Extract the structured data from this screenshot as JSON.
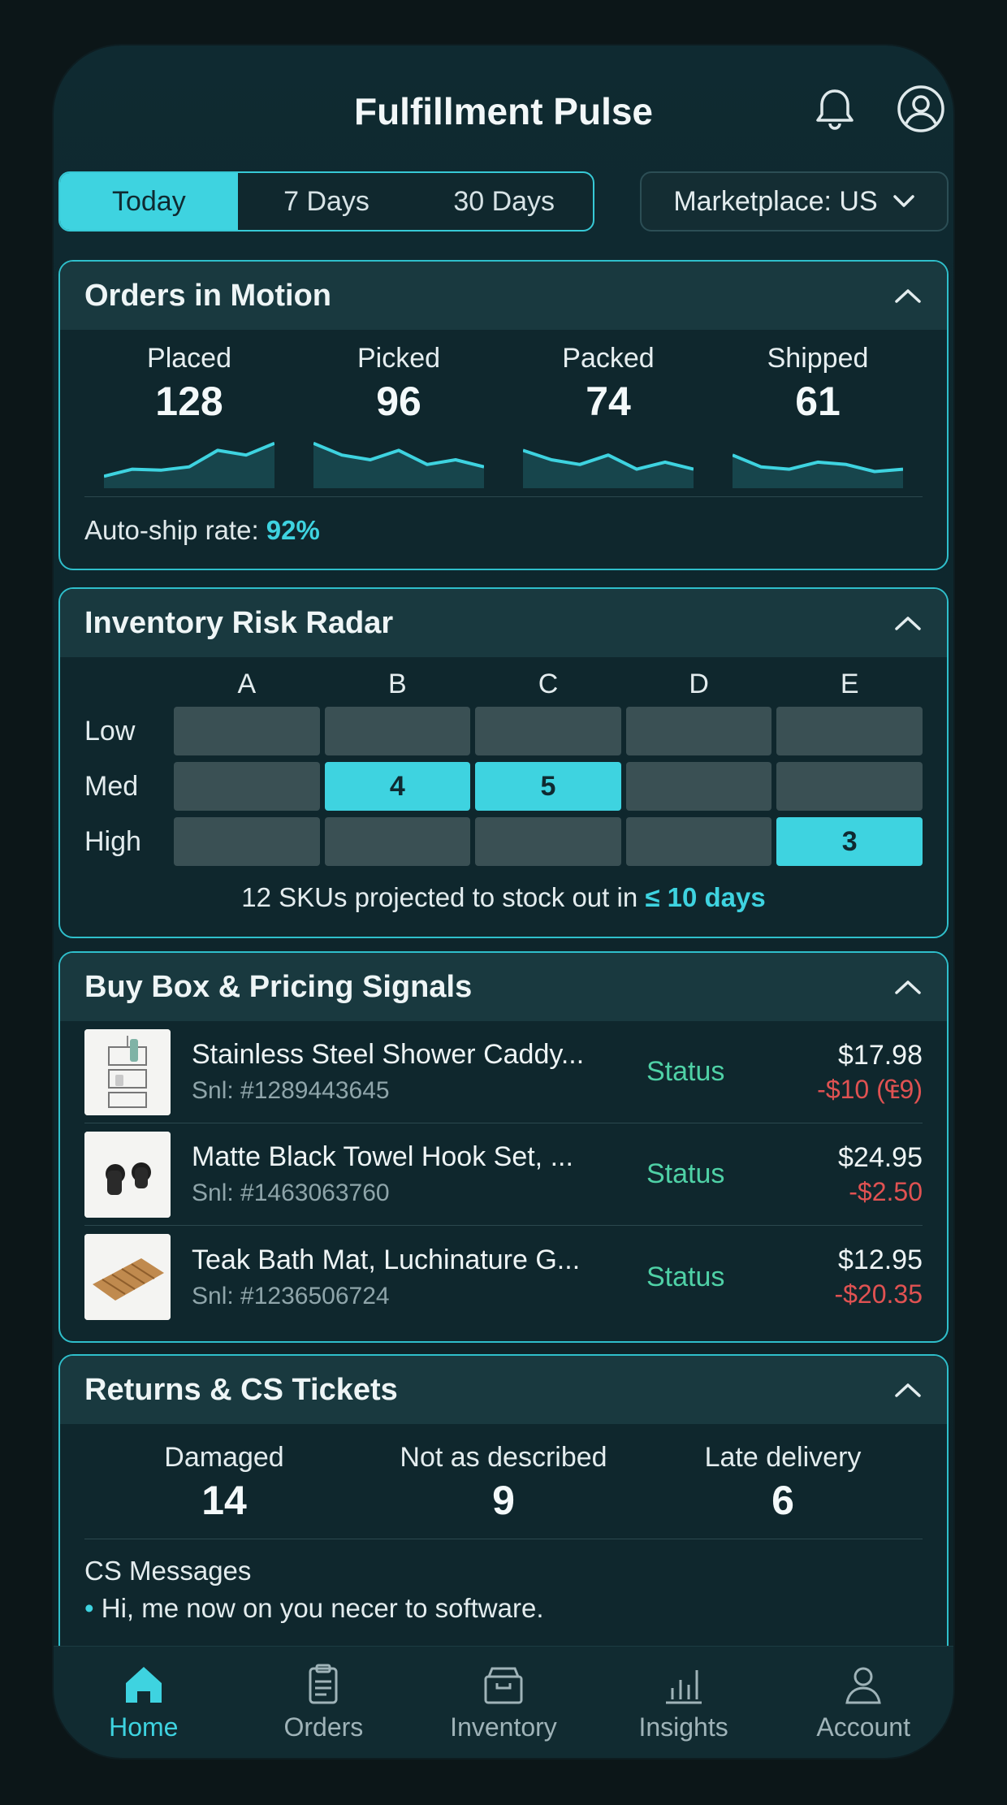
{
  "header": {
    "title": "Fulfillment Pulse"
  },
  "range": {
    "options": [
      "Today",
      "7 Days",
      "30 Days"
    ],
    "selected": "Today"
  },
  "marketplace": {
    "label": "Marketplace: US"
  },
  "orders": {
    "title": "Orders in Motion",
    "kpis": [
      {
        "label": "Placed",
        "value": "128",
        "trend": [
          0.15,
          0.3,
          0.28,
          0.35,
          0.7,
          0.6,
          0.85
        ]
      },
      {
        "label": "Picked",
        "value": "96",
        "trend": [
          0.85,
          0.6,
          0.5,
          0.7,
          0.4,
          0.5,
          0.35
        ]
      },
      {
        "label": "Packed",
        "value": "74",
        "trend": [
          0.7,
          0.5,
          0.4,
          0.6,
          0.3,
          0.45,
          0.3
        ]
      },
      {
        "label": "Shipped",
        "value": "61",
        "trend": [
          0.6,
          0.35,
          0.3,
          0.45,
          0.4,
          0.25,
          0.3
        ]
      }
    ],
    "autoship_label": "Auto-ship rate:",
    "autoship_value": "92%"
  },
  "inventory": {
    "title": "Inventory Risk Radar",
    "columns": [
      "A",
      "B",
      "C",
      "D",
      "E"
    ],
    "rows": [
      {
        "label": "Low",
        "cells": [
          "",
          "",
          "",
          "",
          ""
        ]
      },
      {
        "label": "Med",
        "cells": [
          "",
          "4",
          "5",
          "",
          ""
        ]
      },
      {
        "label": "High",
        "cells": [
          "",
          "",
          "",
          "",
          "3"
        ]
      }
    ],
    "note_prefix": "12 SKUs projected to stock out in",
    "note_highlight": "≤ 10 days"
  },
  "buybox": {
    "title": "Buy Box & Pricing Signals",
    "items": [
      {
        "name": "Stainless Steel Shower Caddy...",
        "sku": "Snl: #1289443645",
        "status": "Status",
        "price": "$17.98",
        "delta": "-$10 (₠9)"
      },
      {
        "name": "Matte Black Towel Hook Set, ...",
        "sku": "Snl: #1463063760",
        "status": "Status",
        "price": "$24.95",
        "delta": "-$2.50"
      },
      {
        "name": "Teak Bath Mat, Luchinature G...",
        "sku": "Snl: #1236506724",
        "status": "Status",
        "price": "$12.95",
        "delta": "-$20.35"
      }
    ]
  },
  "returns": {
    "title": "Returns & CS Tickets",
    "kpis": [
      {
        "label": "Damaged",
        "value": "14"
      },
      {
        "label": "Not as described",
        "value": "9"
      },
      {
        "label": "Late delivery",
        "value": "6"
      }
    ],
    "cs_title": "CS Messages",
    "cs_messages": [
      "Hi, me now on you necer to software."
    ]
  },
  "tabs": [
    {
      "label": "Home",
      "icon": "home-icon",
      "active": true
    },
    {
      "label": "Orders",
      "icon": "clipboard-icon",
      "active": false
    },
    {
      "label": "Inventory",
      "icon": "box-icon",
      "active": false
    },
    {
      "label": "Insights",
      "icon": "bar-chart-icon",
      "active": false
    },
    {
      "label": "Account",
      "icon": "person-icon",
      "active": false
    }
  ],
  "colors": {
    "accent": "#3ed3e0",
    "negative": "#e05252",
    "status": "#4fd1a6"
  }
}
